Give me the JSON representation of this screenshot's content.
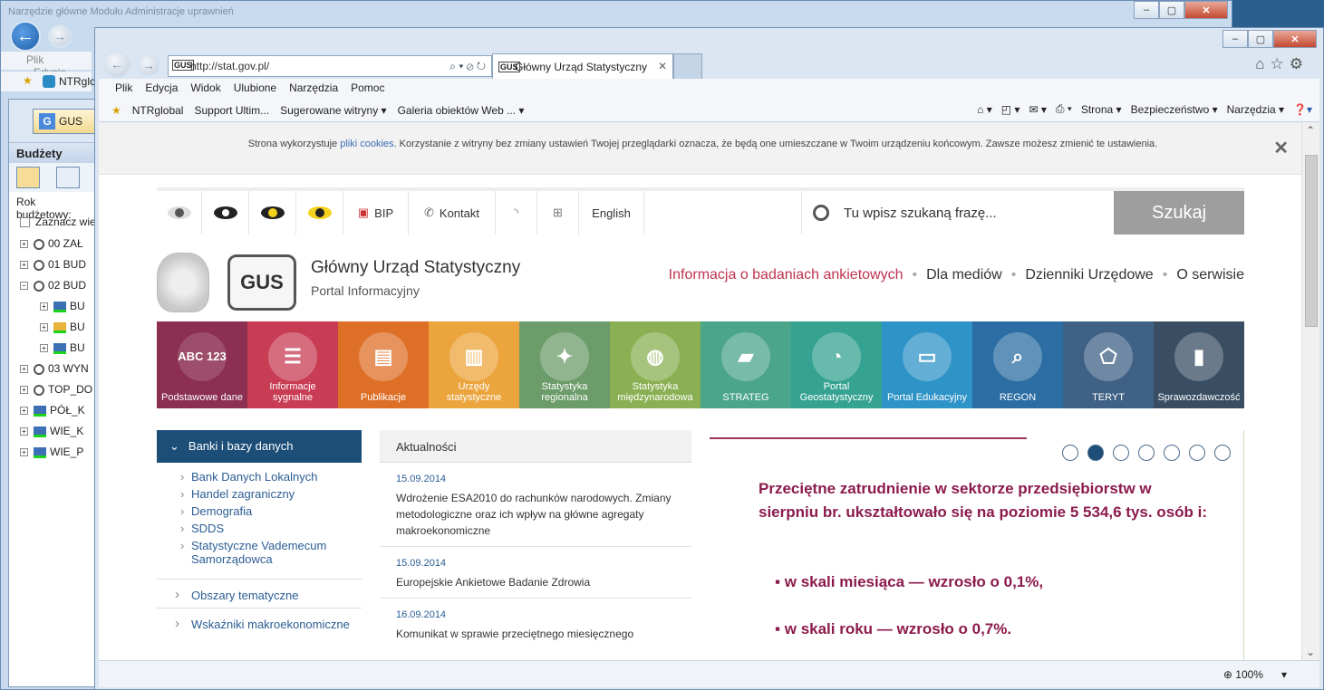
{
  "background_window": {
    "title": "Narzędzie główne Modułu Administracje uprawnień",
    "menu": [
      "Plik",
      "Edycja"
    ],
    "favorite": "NTRglo",
    "panel": {
      "gus_button": "GUS",
      "header": "Budżety",
      "year_label": "Rok budżetowy:",
      "select_all": "Zaznacz wie",
      "tree": [
        "00 ZAŁ",
        "01 BUD",
        "02 BUD",
        "BU",
        "BU",
        "BU",
        "03 WYN",
        "TOP_DO",
        "PÓŁ_K",
        "WIE_K",
        "WIE_P"
      ]
    }
  },
  "browser": {
    "address": "http://stat.gov.pl/",
    "tab_title": "Główny Urząd Statystyczny",
    "favicon_text": "GUS",
    "menu": [
      "Plik",
      "Edycja",
      "Widok",
      "Ulubione",
      "Narzędzia",
      "Pomoc"
    ],
    "favorites": [
      "NTRglobal",
      "Support Ultim...",
      "Sugerowane witryny ▾",
      "Galeria obiektów Web ... ▾"
    ],
    "commands": [
      "Strona ▾",
      "Bezpieczeństwo ▾",
      "Narzędzia ▾"
    ],
    "zoom": "100%"
  },
  "page": {
    "cookie_text_1": "Strona wykorzystuje ",
    "cookie_link": "pliki cookies",
    "cookie_text_2": ". Korzystanie z witryny bez zmiany ustawień Twojej przeglądarki oznacza, że będą one umieszczane w Twoim urządzeniu końcowym. Zawsze możesz zmienić te ustawienia.",
    "topbar": {
      "bip": "BIP",
      "contact": "Kontakt",
      "english": "English",
      "search_placeholder": "Tu wpisz szukaną frazę...",
      "search_button": "Szukaj"
    },
    "brand": {
      "logo_text": "GUS",
      "name": "Główny Urząd Statystyczny",
      "subtitle": "Portal Informacyjny"
    },
    "links": [
      "Informacja o badaniach ankietowych",
      "Dla mediów",
      "Dzienniki Urzędowe",
      "O serwisie"
    ],
    "tiles": [
      {
        "label": "Podstawowe dane",
        "icon": "ABC 123",
        "color": "#8c2f52"
      },
      {
        "label": "Informacje sygnalne",
        "icon": "☰",
        "color": "#c83c54"
      },
      {
        "label": "Publikacje",
        "icon": "▤",
        "color": "#de6f27"
      },
      {
        "label": "Urzędy statystyczne",
        "icon": "▥",
        "color": "#eca53d"
      },
      {
        "label": "Statystyka regionalna",
        "icon": "✦",
        "color": "#6c9c6a"
      },
      {
        "label": "Statystyka międzynarodowa",
        "icon": "◍",
        "color": "#8ab053"
      },
      {
        "label": "STRATEG",
        "icon": "▰",
        "color": "#4ba58b"
      },
      {
        "label": "Portal Geostatystyczny",
        "icon": "◔",
        "color": "#36a392"
      },
      {
        "label": "Portal Edukacyjny",
        "icon": "▭",
        "color": "#2e93c7"
      },
      {
        "label": "REGON",
        "icon": "⌕",
        "color": "#2c6ea3"
      },
      {
        "label": "TERYT",
        "icon": "⬠",
        "color": "#3f6185"
      },
      {
        "label": "Sprawozdawczość",
        "icon": "▮",
        "color": "#394e63"
      }
    ],
    "left_nav": {
      "active": "Banki i bazy danych",
      "items": [
        "Bank Danych Lokalnych",
        "Handel zagraniczny",
        "Demografia",
        "SDDS",
        "Statystyczne Vademecum Samorządowca"
      ],
      "sections": [
        "Obszary tematyczne",
        "Wskaźniki makroekonomiczne"
      ]
    },
    "news": {
      "header": "Aktualności",
      "items": [
        {
          "date": "15.09.2014",
          "title": "Wdrożenie ESA2010 do rachunków narodowych. Zmiany metodologiczne oraz ich wpływ na główne agregaty makroekonomiczne"
        },
        {
          "date": "15.09.2014",
          "title": "Europejskie Ankietowe Badanie Zdrowia"
        },
        {
          "date": "16.09.2014",
          "title": "Komunikat w sprawie przeciętnego miesięcznego"
        }
      ]
    },
    "slide": {
      "headline": "Przeciętne zatrudnienie w sektorze przedsiębiorstw w sierpniu br. ukształtowało się na poziomie 5 534,6 tys. osób i:",
      "bullet1": "▪ w skali miesiąca — wzrosło o 0,1%,",
      "bullet2": "▪ w skali roku — wzrosło o 0,7%."
    }
  }
}
